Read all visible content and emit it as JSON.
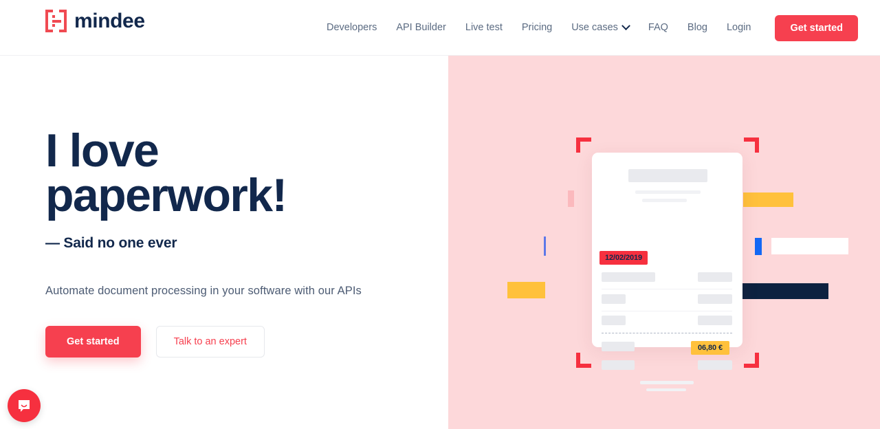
{
  "header": {
    "logo": {
      "text": "mindee",
      "icon": "mindee-bracket-logo",
      "color": "#f04a52"
    },
    "nav_items": [
      {
        "label": "Developers",
        "has_chevron": false
      },
      {
        "label": "API Builder",
        "has_chevron": false
      },
      {
        "label": "Live test",
        "has_chevron": false
      },
      {
        "label": "Pricing",
        "has_chevron": false
      },
      {
        "label": "Use cases",
        "has_chevron": true
      },
      {
        "label": "FAQ",
        "has_chevron": false
      },
      {
        "label": "Blog",
        "has_chevron": false
      },
      {
        "label": "Login",
        "has_chevron": false
      }
    ],
    "cta_label": "Get started"
  },
  "hero": {
    "title_line1": "I love",
    "title_line2": "paperwork!",
    "subtitle": "— Said no one ever",
    "lede": "Automate document processing in your software with our APIs",
    "primary_button": "Get started",
    "secondary_button": "Talk to an expert",
    "background_color": "#fdd8da",
    "accent_color": "#f6404f",
    "text_color": "#12284c"
  },
  "illustration": {
    "date_badge": "12/02/2019",
    "price_badge": "06,80 €",
    "date_badge_color": "#f6303f",
    "price_badge_color": "#ffc13c",
    "scanner_bracket_color": "#f6303f",
    "card_color": "#ffffff"
  },
  "chat_widget": {
    "icon": "chat-bubble-icon",
    "color": "#f6303f"
  }
}
